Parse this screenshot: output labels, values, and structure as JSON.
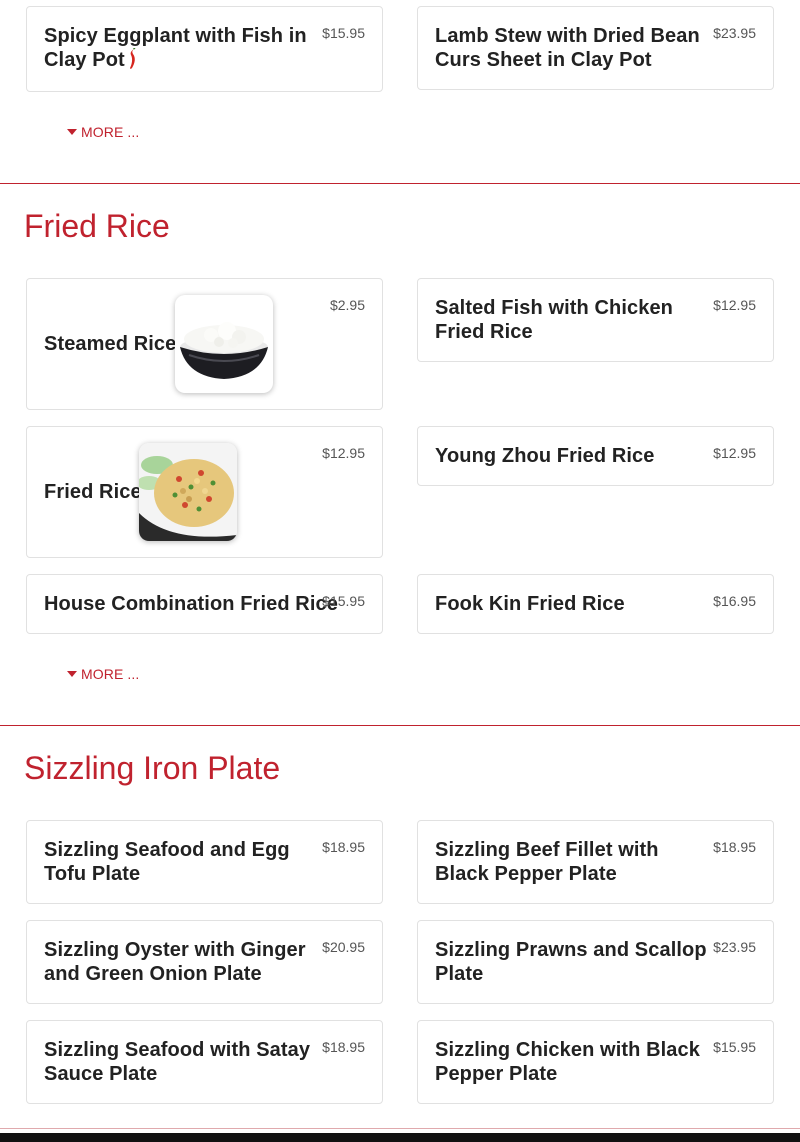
{
  "top_section": {
    "items": [
      {
        "name": "Spicy Eggplant with Fish in Clay Pot",
        "price": "$15.95",
        "spicy": true
      },
      {
        "name": "Lamb Stew with Dried Bean Curs Sheet in Clay Pot",
        "price": "$23.95"
      }
    ],
    "more_label": "MORE ..."
  },
  "fried_rice": {
    "title": "Fried Rice",
    "items": [
      {
        "name": "Steamed Rice",
        "price": "$2.95",
        "image": "steamed-rice-photo"
      },
      {
        "name": "Salted Fish with Chicken Fried Rice",
        "price": "$12.95"
      },
      {
        "name": "Fried Rice",
        "price": "$12.95",
        "image": "fried-rice-photo"
      },
      {
        "name": "Young Zhou Fried Rice",
        "price": "$12.95"
      },
      {
        "name": "House Combination Fried Rice",
        "price": "$15.95"
      },
      {
        "name": "Fook Kin Fried Rice",
        "price": "$16.95"
      }
    ],
    "more_label": "MORE ..."
  },
  "sizzling": {
    "title": "Sizzling Iron Plate",
    "items": [
      {
        "name": "Sizzling Seafood and Egg Tofu Plate",
        "price": "$18.95"
      },
      {
        "name": "Sizzling Beef Fillet with Black Pepper Plate",
        "price": "$18.95"
      },
      {
        "name": "Sizzling Oyster with Ginger and Green Onion Plate",
        "price": "$20.95"
      },
      {
        "name": "Sizzling Prawns and Scallop Plate",
        "price": "$23.95"
      },
      {
        "name": "Sizzling Seafood with Satay Sauce Plate",
        "price": "$18.95"
      },
      {
        "name": "Sizzling Chicken with Black Pepper Plate",
        "price": "$15.95"
      }
    ]
  },
  "colors": {
    "accent": "#c0222e",
    "border": "#e1e1e1",
    "text": "#222222"
  }
}
